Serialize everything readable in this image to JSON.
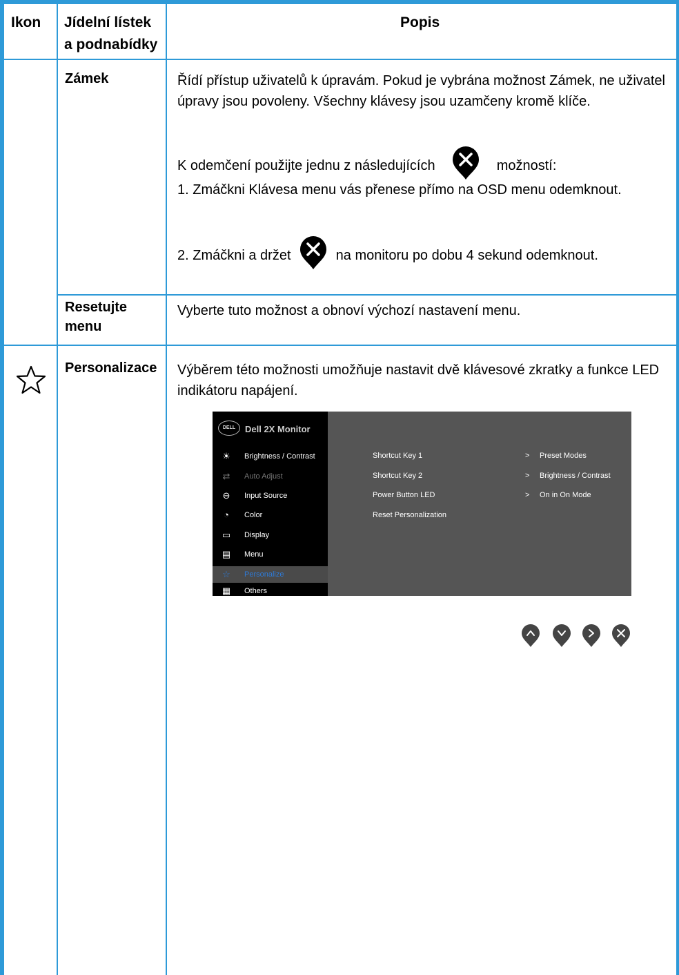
{
  "header": {
    "col_icon": "Ikon",
    "col_menu_line1": "Jídelní lístek",
    "col_menu_line2": "a podnabídky",
    "col_desc": "Popis"
  },
  "rows": {
    "lock": {
      "name": "Zámek",
      "p1": "Řídí přístup uživatelů k úpravám. Pokud je vybrána možnost Zámek, ne uživatel úpravy jsou povoleny. Všechny klávesy jsou uzamčeny kromě klíče.",
      "p2_before": "K odemčení použijte jednu z následujících",
      "p2_after": "možností:",
      "p3": "1.  Zmáčkni Klávesa menu vás přenese přímo na OSD menu odemknout.",
      "p4_before": "2.  Zmáčkni a držet",
      "p4_after": "na monitoru po dobu 4 sekund odemknout."
    },
    "reset": {
      "name_line1": "Resetujte",
      "name_line2": "menu",
      "desc": "Vyberte tuto možnost a obnoví výchozí nastavení menu."
    },
    "personalize": {
      "icon": "star-outline-icon",
      "name": "Personalizace",
      "desc": "Výběrem této možnosti umožňuje nastavit dvě klávesové zkratky a funkce LED indikátoru napájení."
    }
  },
  "osd": {
    "logo": "DELL",
    "title": "Dell 2X Monitor",
    "menu": [
      {
        "icon": "brightness-icon",
        "glyph": "☀",
        "label": "Brightness / Contrast",
        "state": "normal"
      },
      {
        "icon": "auto-adjust-icon",
        "glyph": "⇄",
        "label": "Auto Adjust",
        "state": "dim"
      },
      {
        "icon": "input-source-icon",
        "glyph": "⊖",
        "label": "Input Source",
        "state": "normal"
      },
      {
        "icon": "color-icon",
        "glyph": "◔",
        "label": "Color",
        "state": "normal"
      },
      {
        "icon": "display-icon",
        "glyph": "▭",
        "label": "Display",
        "state": "normal"
      },
      {
        "icon": "menu-icon",
        "glyph": "▤",
        "label": "Menu",
        "state": "normal"
      },
      {
        "icon": "star-icon",
        "glyph": "☆",
        "label": "Personalize",
        "state": "active"
      },
      {
        "icon": "others-icon",
        "glyph": "▦",
        "label": "Others",
        "state": "normal"
      }
    ],
    "settings": [
      {
        "label": "Shortcut Key 1",
        "arrow": ">",
        "value": "Preset Modes"
      },
      {
        "label": "Shortcut Key 2",
        "arrow": ">",
        "value": "Brightness / Contrast"
      },
      {
        "label": "Power Button LED",
        "arrow": ">",
        "value": "On in On Mode"
      },
      {
        "label": "Reset Personalization",
        "arrow": "",
        "value": ""
      }
    ],
    "buttons": [
      {
        "icon": "up-button-icon",
        "glyph": "^"
      },
      {
        "icon": "down-button-icon",
        "glyph": "v"
      },
      {
        "icon": "right-button-icon",
        "glyph": ">"
      },
      {
        "icon": "close-button-icon",
        "glyph": "×"
      }
    ]
  },
  "colors": {
    "border": "#2e9ad8",
    "osd_panel": "#555555",
    "osd_menu": "#000000",
    "osd_active": "#2e7bd8"
  }
}
